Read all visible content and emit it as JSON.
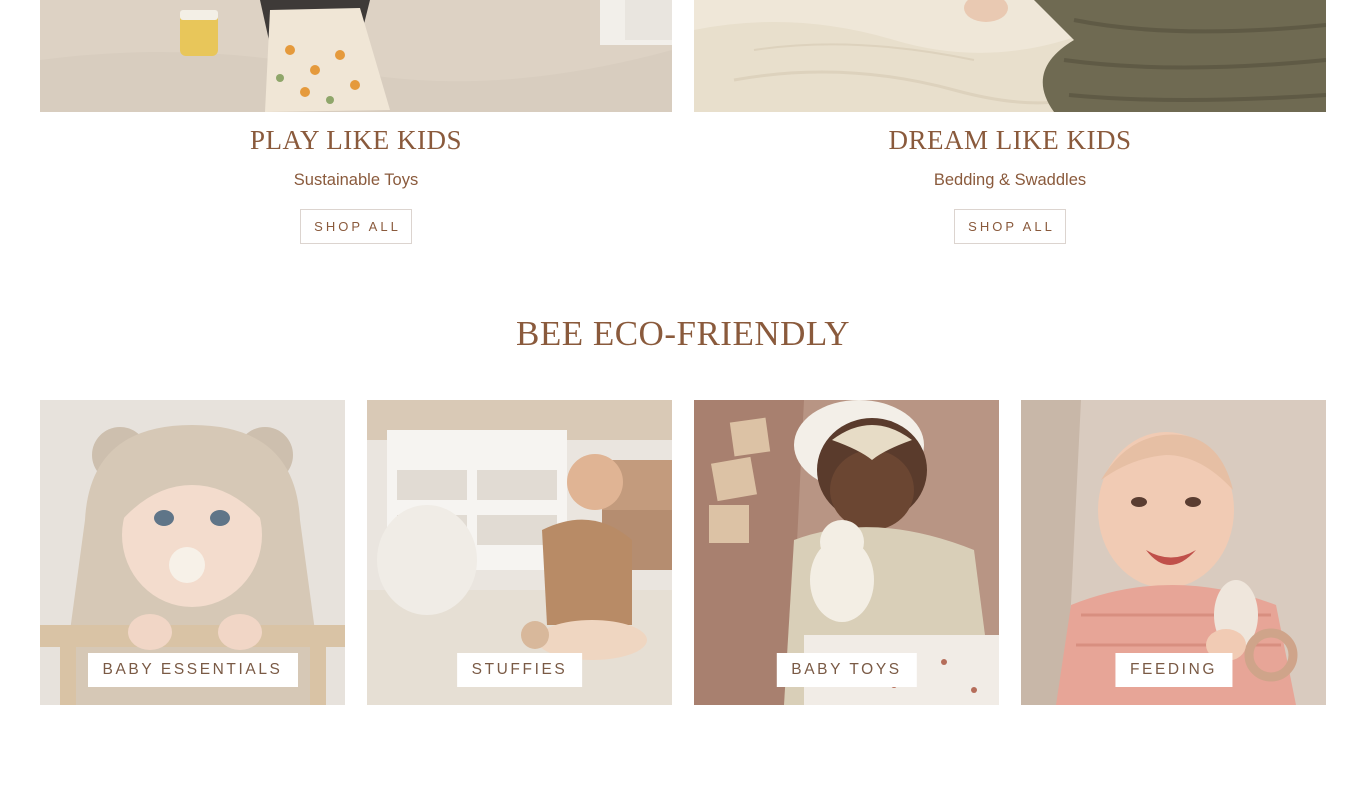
{
  "promos": [
    {
      "title": "PLAY LIKE KIDS",
      "subtitle": "Sustainable Toys",
      "button": "SHOP ALL"
    },
    {
      "title": "DREAM LIKE KIDS",
      "subtitle": "Bedding & Swaddles",
      "button": "SHOP ALL"
    }
  ],
  "section": {
    "title": "BEE ECO-FRIENDLY"
  },
  "categories": [
    {
      "label": "BABY ESSENTIALS"
    },
    {
      "label": "STUFFIES"
    },
    {
      "label": "BABY TOYS"
    },
    {
      "label": "FEEDING"
    }
  ],
  "colors": {
    "brand_brown": "#8a5a3c",
    "button_border": "#dcd4cf",
    "background": "#ffffff"
  }
}
